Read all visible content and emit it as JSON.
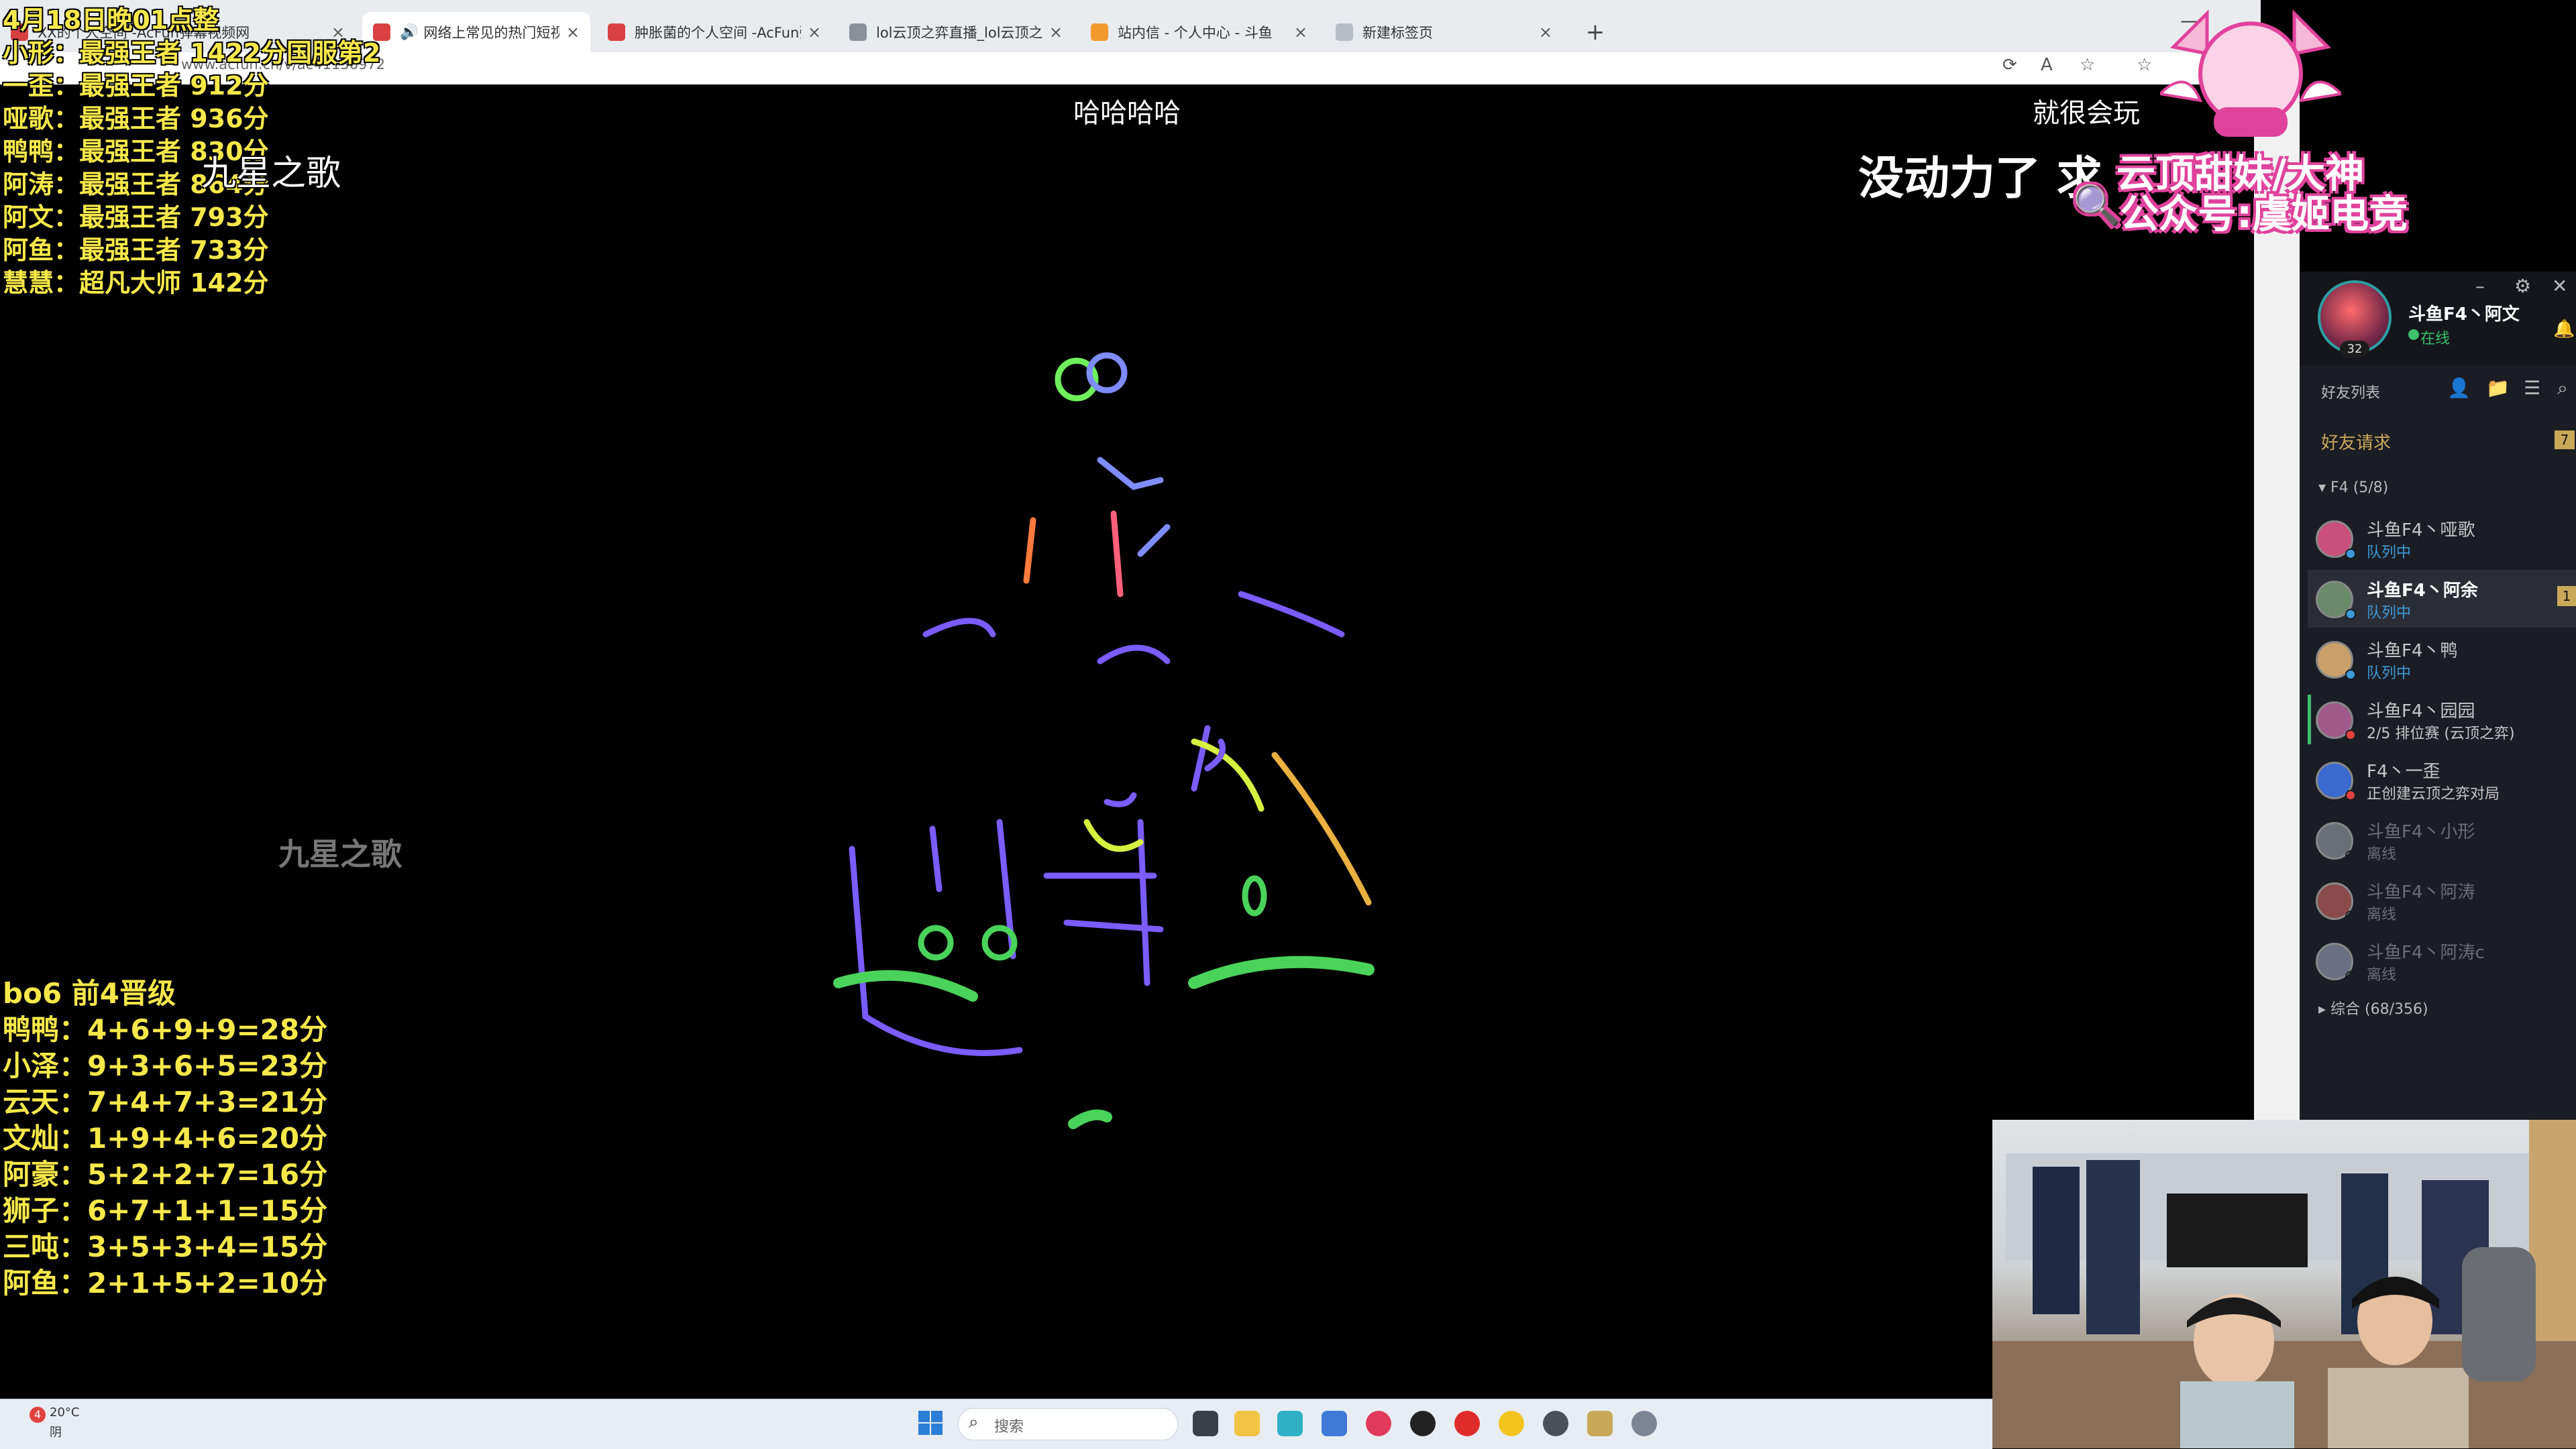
{
  "browser": {
    "tabs": [
      {
        "title": "XX的个人空间 -AcFun弹幕视频网",
        "icon": "acfun-icon",
        "active": false
      },
      {
        "title": "网络上常见的热门短视频集锦",
        "icon": "acfun-icon",
        "active": true
      },
      {
        "title": "肿胀菌的个人空间 -AcFun弹幕视频网",
        "icon": "acfun-icon",
        "active": false
      },
      {
        "title": "lol云顶之弈直播_lol云顶之弈直播",
        "icon": "lol-icon",
        "active": false
      },
      {
        "title": "站内信 - 个人中心 - 斗鱼",
        "icon": "douyu-icon",
        "active": false
      },
      {
        "title": "新建标签页",
        "icon": "newtab-icon",
        "active": false
      }
    ],
    "url": "www.acfun.cn/v/ac41136972"
  },
  "overlay": {
    "rank_list": [
      "4月18日晚01点整",
      "小形：最强王者 1422分国服第2",
      "一歪：最强王者 912分",
      "哑歌：最强王者 936分",
      "鸭鸭：最强王者 830分",
      "阿涛：最强王者 864分",
      "阿文：最强王者 793分",
      "阿鱼：最强王者 733分",
      "慧慧：超凡大师 142分"
    ],
    "score_list": [
      "bo6  前4晋级",
      "鸭鸭：4+6+9+9=28分",
      "小泽：9+3+6+5=23分",
      "云天：7+4+7+3=21分",
      "文灿：1+9+4+6=20分",
      "阿豪：5+2+2+7=16分",
      "狮子：6+7+1+1=15分",
      "三吨：3+5+3+4=15分",
      "阿鱼：2+1+5+2=10分"
    ],
    "watermark_top": "九星之歌",
    "watermark_mid": "九星之歌",
    "subtitle_left": "哈哈哈哈",
    "subtitle_right": "就很会玩",
    "big_caption": "没动力了 求",
    "pink_line1": "云顶甜妹/大神",
    "pink_line2": "公众号:虞姬电竞"
  },
  "friends_panel": {
    "me": {
      "name": "斗鱼F4丶阿文",
      "status": "在线",
      "level": "32"
    },
    "title": "好友列表",
    "friend_requests": "好友请求",
    "request_count": "7",
    "group_f4": "F4 (5/8)",
    "group_all": "综合 (68/356)",
    "friends": [
      {
        "name": "斗鱼F4丶哑歌",
        "status": "队列中",
        "state": "queue",
        "selected": false,
        "badge": ""
      },
      {
        "name": "斗鱼F4丶阿余",
        "status": "队列中",
        "state": "queue",
        "selected": true,
        "badge": "1"
      },
      {
        "name": "斗鱼F4丶鸭",
        "status": "队列中",
        "state": "queue",
        "selected": false,
        "badge": ""
      },
      {
        "name": "斗鱼F4丶园园",
        "status": "2/5 排位赛 (云顶之弈)",
        "state": "ingame",
        "selected": false,
        "badge": ""
      },
      {
        "name": "F4丶一歪",
        "status": "正创建云顶之弈对局",
        "state": "ingame",
        "selected": false,
        "badge": ""
      },
      {
        "name": "斗鱼F4丶小形",
        "status": "离线",
        "state": "offline",
        "selected": false,
        "badge": ""
      },
      {
        "name": "斗鱼F4丶阿涛",
        "status": "离线",
        "state": "offline",
        "selected": false,
        "badge": ""
      },
      {
        "name": "斗鱼F4丶阿涛c",
        "status": "离线",
        "state": "offline",
        "selected": false,
        "badge": ""
      }
    ]
  },
  "taskbar": {
    "weather_badge": "4",
    "weather_temp": "20°C",
    "weather_desc": "阴",
    "search_placeholder": "搜索"
  },
  "colors": {
    "overlay_yellow": "#f7e84a",
    "online_green": "#3dbf6b",
    "queue_blue": "#3d9ad9",
    "gold": "#c9a85a",
    "pink": "#e0429c"
  }
}
